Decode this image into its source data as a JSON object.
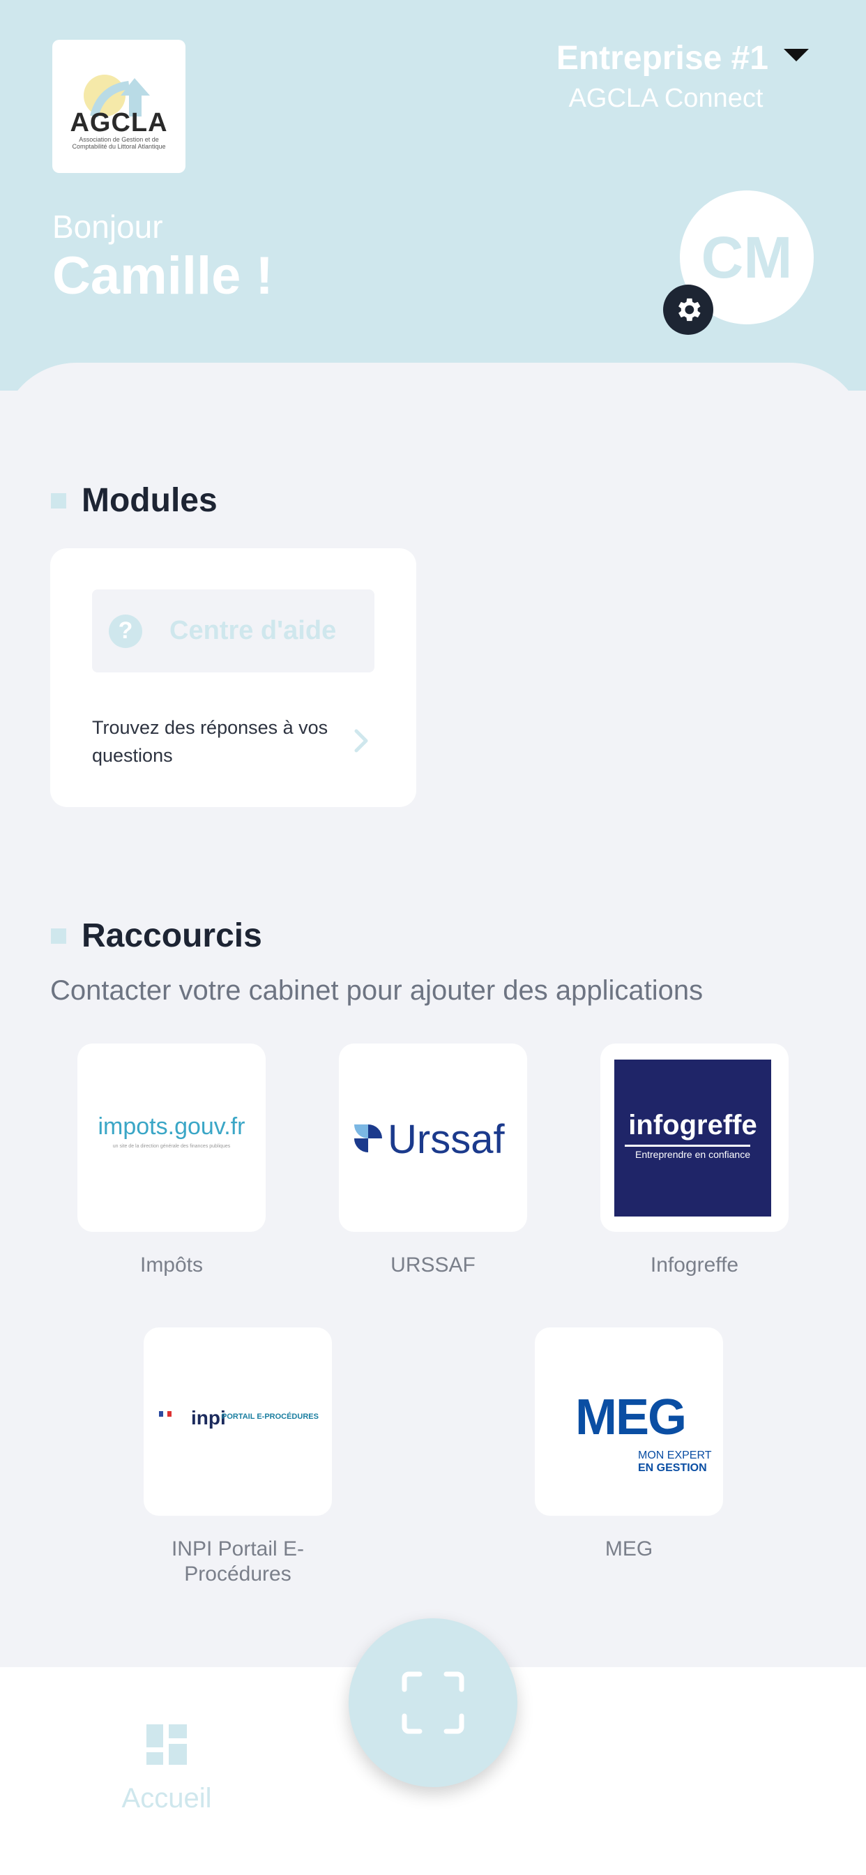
{
  "header": {
    "logo": {
      "text": "AGCLA",
      "subtitle": "Association de Gestion et de Comptabilité du Littoral Atlantique"
    },
    "company": {
      "name": "Entreprise #1",
      "app_name": "AGCLA Connect"
    },
    "greeting": "Bonjour",
    "user_name": "Camille !",
    "avatar_initials": "CM"
  },
  "modules": {
    "title": "Modules",
    "cards": [
      {
        "label": "Centre d'aide",
        "description": "Trouvez des réponses à vos questions",
        "icon": "help-icon"
      }
    ]
  },
  "shortcuts": {
    "title": "Raccourcis",
    "subtitle": "Contacter votre cabinet pour ajouter des applications",
    "apps": [
      {
        "label": "Impôts",
        "logo_text": "impots.gouv.fr",
        "logo_sub": "un site de la direction générale des finances publiques"
      },
      {
        "label": "URSSAF",
        "logo_text": "Urssaf"
      },
      {
        "label": "Infogreffe",
        "logo_text": "infogreffe",
        "logo_sub": "Entreprendre en confiance"
      },
      {
        "label": "INPI Portail E-Procédures",
        "logo_text": "inpi",
        "logo_sub": "PORTAIL E-PROCÉDURES"
      },
      {
        "label": "MEG",
        "logo_text": "MEG",
        "logo_sub1": "MON EXPERT",
        "logo_sub2": "EN GESTION"
      }
    ]
  },
  "bottom_nav": {
    "home_label": "Accueil"
  },
  "colors": {
    "accent": "#cfe7ed",
    "text_dark": "#1d2433",
    "background": "#f2f3f7",
    "infogreffe_bg": "#1f2568",
    "urssaf_blue": "#1b3a8c",
    "meg_blue": "#0a4ea3"
  }
}
